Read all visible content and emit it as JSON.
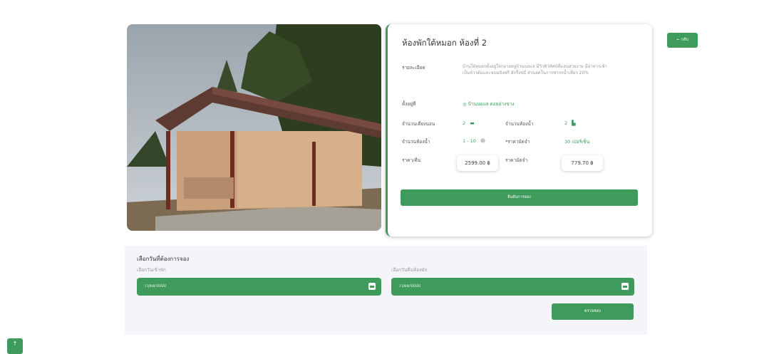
{
  "room": {
    "title": "ห้องพักใต้หมอก ห้องที่ 2",
    "desc_label": "รายละเอียด",
    "desc_text": "บ้านใต้หมอกตั้งอยู่ใจกลางหมู่บ้านนอแล มีวิวทิวทัศน์ที่แสนสวยงาม มีอาหารเช้าเป็นข้าวต้มและขนมปังฟรี ฮักรึ่งข่มี ส่วนลดในการซ่ากรน้ำเที่ยว 20%",
    "location_label": "ตั้งอยู่ที่",
    "location_value": "บ้านนอแล ดอยอ่างขาง",
    "beds_label": "จำนวนเตียงนอน",
    "beds_value": "2",
    "bath_label": "จำนวนห้องน้ำ",
    "bath_value": "2",
    "guests_label": "จำนวนห้องน้ำ",
    "guests_value": "1 - 10",
    "deposit_pct_label": "*ราคามัดจำ",
    "deposit_pct_value": "30 เปอร์เซ็น",
    "price_label": "ราคา/คืน",
    "price_value": "2599.00 ฿",
    "deposit_label": "ราคามัดจำ",
    "deposit_value": "779.70 ฿",
    "book_button": "ยืนยันการจอง",
    "back_button": "← กลับ"
  },
  "booking": {
    "title": "เลือกวันที่ต้องการจอง",
    "checkin_label": "เลือกวันเข้าพัก",
    "checkout_label": "เลือกวันคืนห้องพัก",
    "checkin_placeholder": "วว/ดด/ปปปป",
    "checkout_placeholder": "วว/ดด/ปปปป",
    "check_button": "ตรวจสอบ"
  },
  "scroll_top": "↑",
  "colors": {
    "accent": "#3e9b5b"
  }
}
